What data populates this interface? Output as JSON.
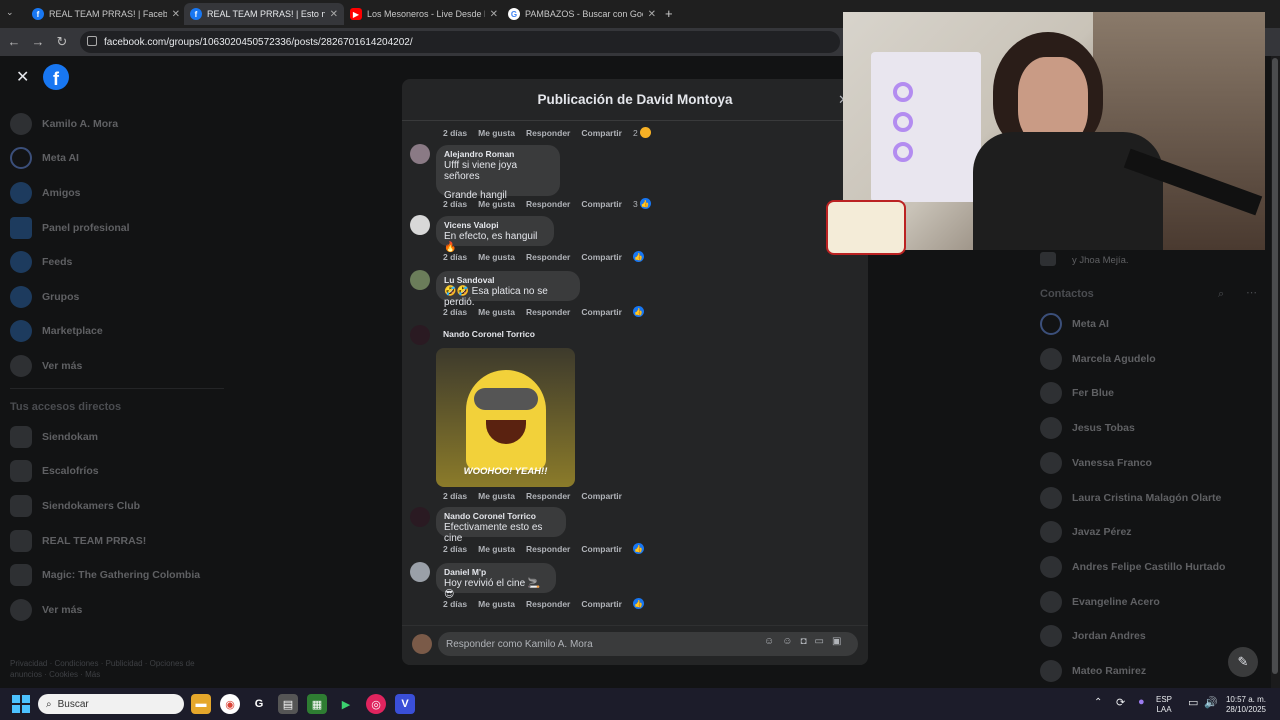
{
  "browser": {
    "tabs": [
      {
        "title": "REAL TEAM PRRAS! | Facebook",
        "active": false,
        "favicon": "facebook-icon"
      },
      {
        "title": "REAL TEAM PRRAS! | Esto no pu",
        "active": true,
        "favicon": "facebook-icon"
      },
      {
        "title": "Los Mesoneros - Live Desde Pa",
        "active": false,
        "favicon": "youtube-icon"
      },
      {
        "title": "PAMBAZOS - Buscar con Googl",
        "active": false,
        "favicon": "google-icon"
      }
    ],
    "url": "facebook.com/groups/1063020450572336/posts/2826701614204202/"
  },
  "sidebar": {
    "items": [
      {
        "label": "Kamilo A. Mora"
      },
      {
        "label": "Meta AI"
      },
      {
        "label": "Amigos"
      },
      {
        "label": "Panel profesional"
      },
      {
        "label": "Feeds"
      },
      {
        "label": "Grupos"
      },
      {
        "label": "Marketplace"
      },
      {
        "label": "Ver más"
      }
    ],
    "shortcuts_title": "Tus accesos directos",
    "shortcuts": [
      {
        "label": "Siendokam"
      },
      {
        "label": "Escalofríos"
      },
      {
        "label": "Siendokamers Club"
      },
      {
        "label": "REAL TEAM PRRAS!"
      },
      {
        "label": "Magic: The Gathering Colombia"
      },
      {
        "label": "Ver más"
      }
    ],
    "footer": "Privacidad · Condiciones · Publicidad · Opciones de anuncios · Cookies · Más"
  },
  "right": {
    "top_fragment": "y Jhoa Mejía.",
    "contacts_title": "Contactos",
    "contacts": [
      "Meta AI",
      "Marcela Agudelo",
      "Fer Blue",
      "Jesus Tobas",
      "Vanessa Franco",
      "Laura Cristina Malagón Olarte",
      "Javaz Pérez",
      "Andres Felipe Castillo Hurtado",
      "Evangeline Acero",
      "Jordan Andres",
      "Mateo Ramirez"
    ]
  },
  "modal": {
    "title": "Publicación de David Montoya",
    "actions": {
      "like": "Me gusta",
      "reply": "Responder",
      "share": "Compartir"
    },
    "top_row": {
      "time": "2 días",
      "count": "2"
    },
    "comments": [
      {
        "name": "Alejandro Roman",
        "lines": [
          "Ufff si viene joya señores"
        ],
        "extra_line": "Grande hangil",
        "time": "2 días",
        "count": "3"
      },
      {
        "name": "Vicens Valopi",
        "lines": [
          "En efecto, es hanguil 🔥"
        ],
        "time": "2 días",
        "count": ""
      },
      {
        "name": "Lu Sandoval",
        "lines": [
          "🤣🤣 Esa platica no se perdió."
        ],
        "time": "2 días",
        "count": ""
      },
      {
        "name": "Nando Coronel Torrico",
        "gif_caption": "WOOHOO! YEAH!!",
        "time": "2 días"
      },
      {
        "name": "Nando Coronel Torrico",
        "lines": [
          "Efectivamente esto es cine"
        ],
        "time": "2 días",
        "count": ""
      },
      {
        "name": "Daniel M'p",
        "lines": [
          "Hoy revivió el cine 🚬😎"
        ],
        "time": "2 días",
        "count": ""
      }
    ],
    "reply_placeholder": "Responder como Kamilo A. Mora"
  },
  "taskbar": {
    "search_label": "Buscar",
    "lang": "ESP",
    "lang2": "LAA",
    "time": "10:57 a. m.",
    "date": "28/10/2025"
  },
  "colors": {
    "accent": "#1877f2",
    "modal_bg": "#242526",
    "bubble_bg": "#3a3b3c"
  }
}
